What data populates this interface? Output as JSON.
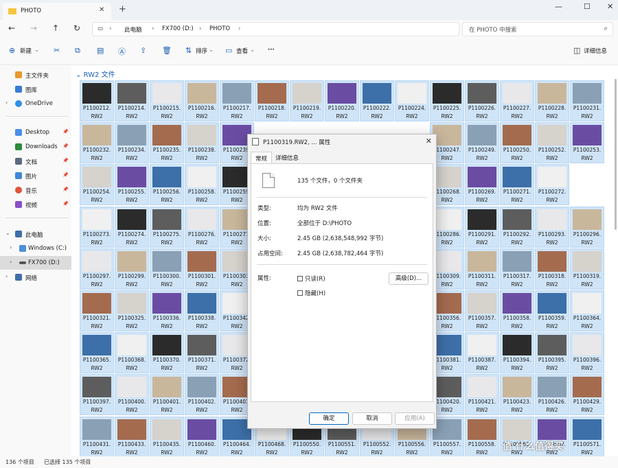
{
  "window": {
    "tab_title": "PHOTO",
    "tab_close": "✕",
    "new_tab": "+",
    "minimize": "—",
    "maximize": "☐",
    "close": "✕"
  },
  "address": {
    "pc_label": "此电脑",
    "drive_label": "FX700 (D:)",
    "folder_label": "PHOTO",
    "search_placeholder": "在 PHOTO 中搜索"
  },
  "toolbar": {
    "new_label": "新建",
    "sort_label": "排序",
    "view_label": "查看",
    "more_label": "···",
    "details_label": "详细信息"
  },
  "sidebar": {
    "items": [
      {
        "label": "主文件夹",
        "color": "#e69a2e"
      },
      {
        "label": "图库",
        "color": "#3a7bd5"
      },
      {
        "label": "OneDrive",
        "color": "#2f8fe3"
      },
      {
        "label": "Desktop",
        "color": "#4a8ee8"
      },
      {
        "label": "Downloads",
        "color": "#2d8a3e"
      },
      {
        "label": "文档",
        "color": "#5a6b7d"
      },
      {
        "label": "图片",
        "color": "#3f88d9"
      },
      {
        "label": "音乐",
        "color": "#e0533b"
      },
      {
        "label": "视频",
        "color": "#8b4fc9"
      },
      {
        "label": "此电脑",
        "color": "#3f6ea8"
      },
      {
        "label": "Windows (C:)",
        "color": "#4f8fd9"
      },
      {
        "label": "FX700 (D:)",
        "color": "#555555"
      },
      {
        "label": "网络",
        "color": "#3f6ea8"
      }
    ]
  },
  "content": {
    "group_header": "RW2 文件",
    "ext": "RW2",
    "thumb_colors": [
      "#2b2b2b",
      "#5d5d5d",
      "#e8e8ea",
      "#c9b79c",
      "#8aa0b5",
      "#a46b4f",
      "#d6d2cc",
      "#6b4ca3",
      "#3d6fa8",
      "#f0f0f0"
    ],
    "rows": [
      [
        "P1100212.",
        "P1100214.",
        "P1100215.",
        "P1100216.",
        "P1100217.",
        "P1100218.",
        "P1100219.",
        "P1100220.",
        "P1100222.",
        "P1100224.",
        "P1100225.",
        "P1100226.",
        "P1100227.",
        "P1100228.",
        "P1100231."
      ],
      [
        "P1100232.",
        "P1100234.",
        "P1100235.",
        "P1100238.",
        "P1100239.",
        "",
        "",
        "",
        "",
        "",
        "P1100247.",
        "P1100249.",
        "P1100250.",
        "P1100252.",
        "P1100253."
      ],
      [
        "P1100254.",
        "P1100255.",
        "P1100256.",
        "P1100258.",
        "P1100259.",
        "",
        "",
        "",
        "",
        "",
        "P1100268.",
        "P1100269.",
        "P1100271.",
        "P1100272."
      ],
      [
        "P1100273.",
        "P1100274.",
        "P1100275.",
        "P1100276.",
        "P1100277.",
        "",
        "",
        "",
        "",
        "",
        "P1100286.",
        "P1100291.",
        "P1100292.",
        "P1100293.",
        "P1100296."
      ],
      [
        "P1100297.",
        "P1100299.",
        "P1100300.",
        "P1100301.",
        "P1100303.",
        "",
        "",
        "",
        "",
        "",
        "P1100309.",
        "P1100311.",
        "P1100317.",
        "P1100318.",
        "P1100319."
      ],
      [
        "P1100321.",
        "P1100325.",
        "P1100336.",
        "P1100338.",
        "P1100342.",
        "",
        "",
        "",
        "",
        "",
        "P1100356.",
        "P1100357.",
        "P1100358.",
        "P1100359.",
        "P1100364."
      ],
      [
        "P1100365.",
        "P1100368.",
        "P1100370.",
        "P1100371.",
        "P1100372.",
        "",
        "",
        "",
        "",
        "",
        "P1100381.",
        "P1100387.",
        "P1100394.",
        "P1100395.",
        "P1100396."
      ],
      [
        "P1100397.",
        "P1100400.",
        "P1100401.",
        "P1100402.",
        "P1100407.",
        "",
        "",
        "",
        "",
        "",
        "P1100420.",
        "P1100421.",
        "P1100423.",
        "P1100426.",
        "P1100429."
      ],
      [
        "P1100431.",
        "P1100433.",
        "P1100435.",
        "P1100460.",
        "P1100464.",
        "P1100468.",
        "P1100550.",
        "P1100551.",
        "P1100552.",
        "P1100556.",
        "P1100557.",
        "P1100558.",
        "P1100562.",
        "P1100567.",
        "P1100571."
      ]
    ]
  },
  "status": {
    "count": "136 个项目",
    "selected": "已选择 135 个项目"
  },
  "watermark": "值 什么值得买",
  "dialog": {
    "title": "P1100319.RW2, ... 属性",
    "tab_general": "常规",
    "tab_details": "详细信息",
    "summary": "135 个文件，0 个文件夹",
    "type_label": "类型:",
    "type_value": "均为 RW2 文件",
    "location_label": "位置:",
    "location_value": "全部位于 D:\\PHOTO",
    "size_label": "大小:",
    "size_value": "2.45 GB (2,638,548,992 字节)",
    "disk_label": "占用空间:",
    "disk_value": "2.45 GB (2,638,782,464 字节)",
    "attr_label": "属性:",
    "readonly_label": "只读(R)",
    "hidden_label": "隐藏(H)",
    "advanced_label": "高级(D)...",
    "ok_label": "确定",
    "cancel_label": "取消",
    "apply_label": "应用(A)"
  }
}
